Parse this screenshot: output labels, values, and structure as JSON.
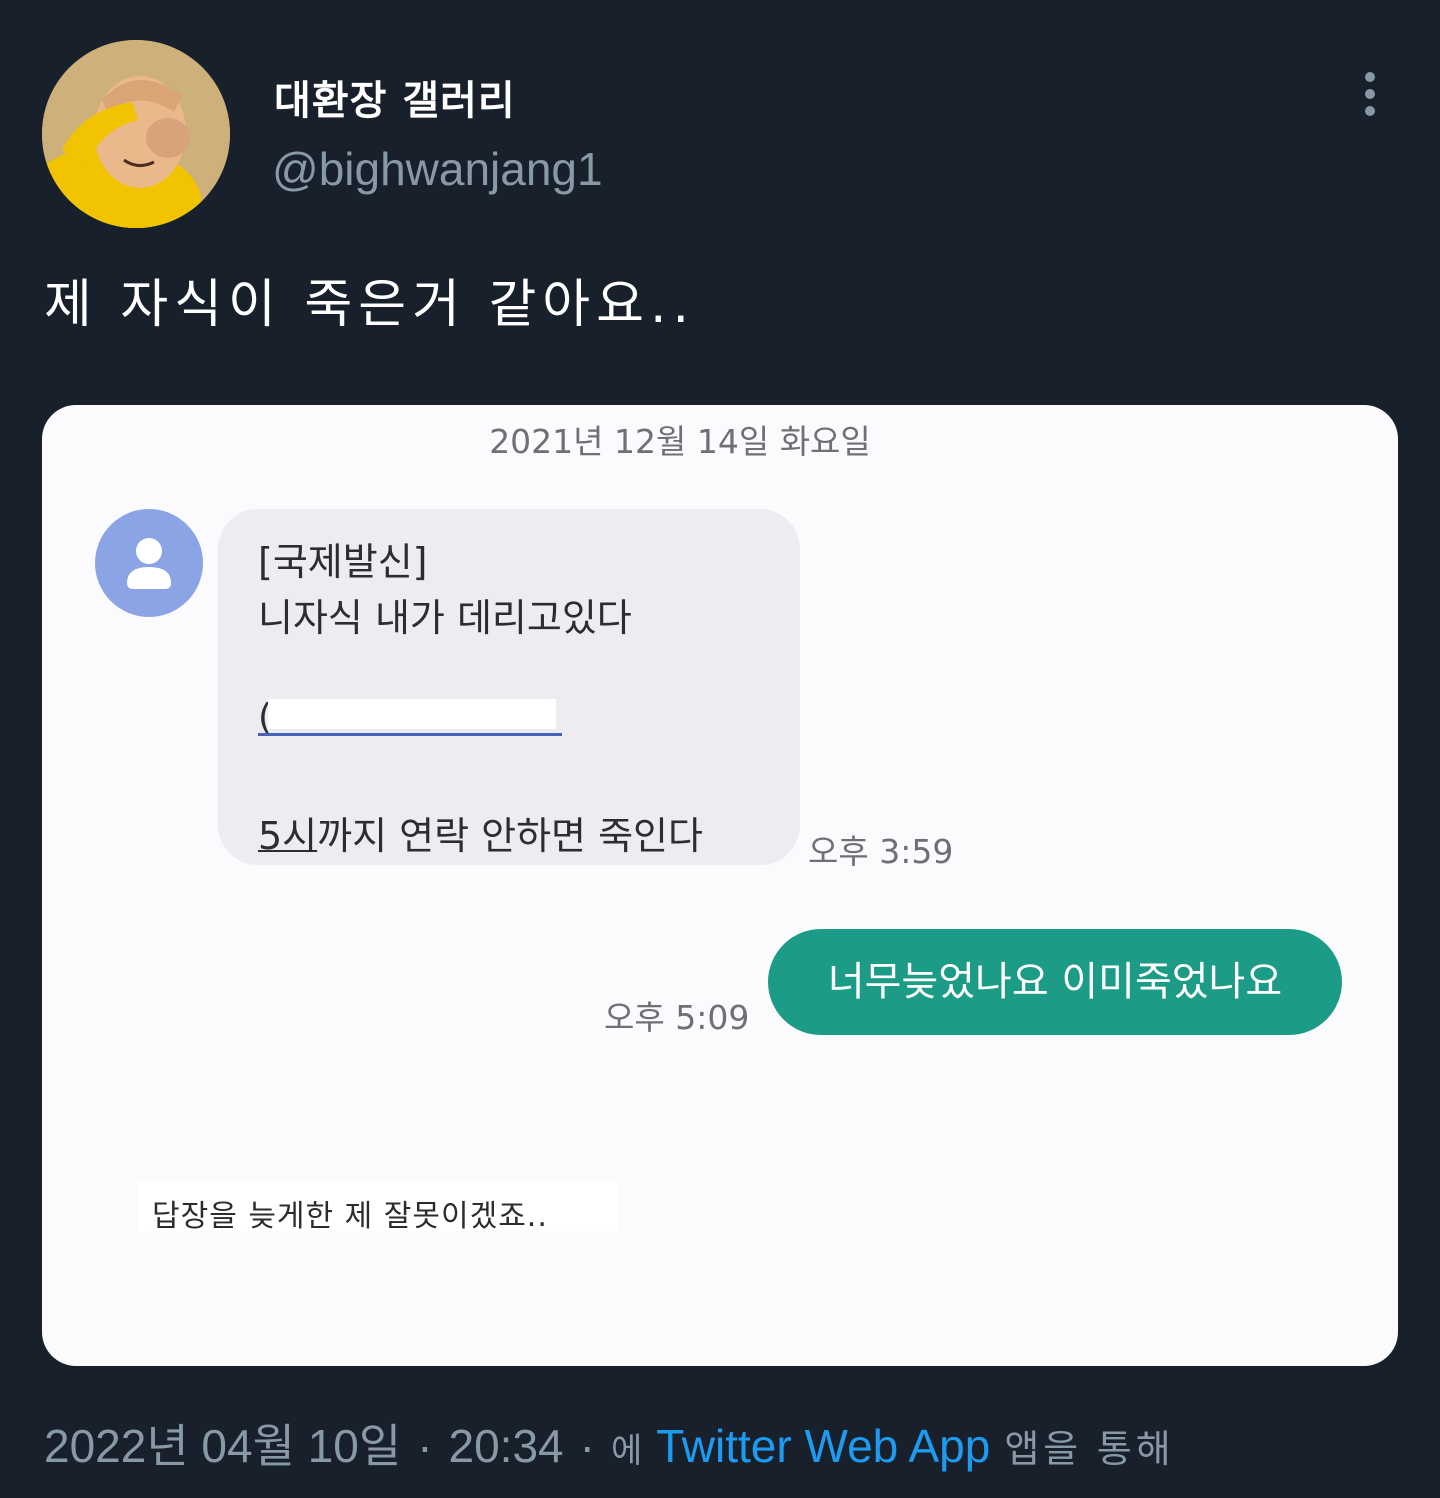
{
  "header": {
    "display_name": "대환장 갤러리",
    "handle": "@bighwanjang1"
  },
  "tweet": {
    "text": "제 자식이 죽은거 같아요.."
  },
  "media": {
    "date_label": "2021년 12월 14일 화요일",
    "incoming": {
      "line1": "[국제발신]",
      "line2": "니자식 내가 데리고있다",
      "link_open": "(",
      "line4_prefix": "5시",
      "line4_rest": "까지 연락 안하면 죽인다",
      "time": "오후 3:59"
    },
    "outgoing": {
      "text": "너무늦었나요 이미죽었나요",
      "time": "오후 5:09"
    },
    "caption": "답장을 늦게한 제 잘못이겠죠.."
  },
  "footer": {
    "date": "2022년 04월 10일",
    "separator1": "·",
    "time": "20:34",
    "separator2": "·",
    "via_prefix": "에",
    "app_name": "Twitter Web App",
    "via_suffix": "앱을 통해"
  },
  "colors": {
    "background": "#17202b",
    "secondary_text": "#8899a6",
    "link": "#1d9bf0",
    "outgoing_bubble": "#1c9b87",
    "incoming_bubble": "#ededf1"
  },
  "icons": {
    "more": "more-vertical-icon",
    "contact": "person-icon"
  }
}
